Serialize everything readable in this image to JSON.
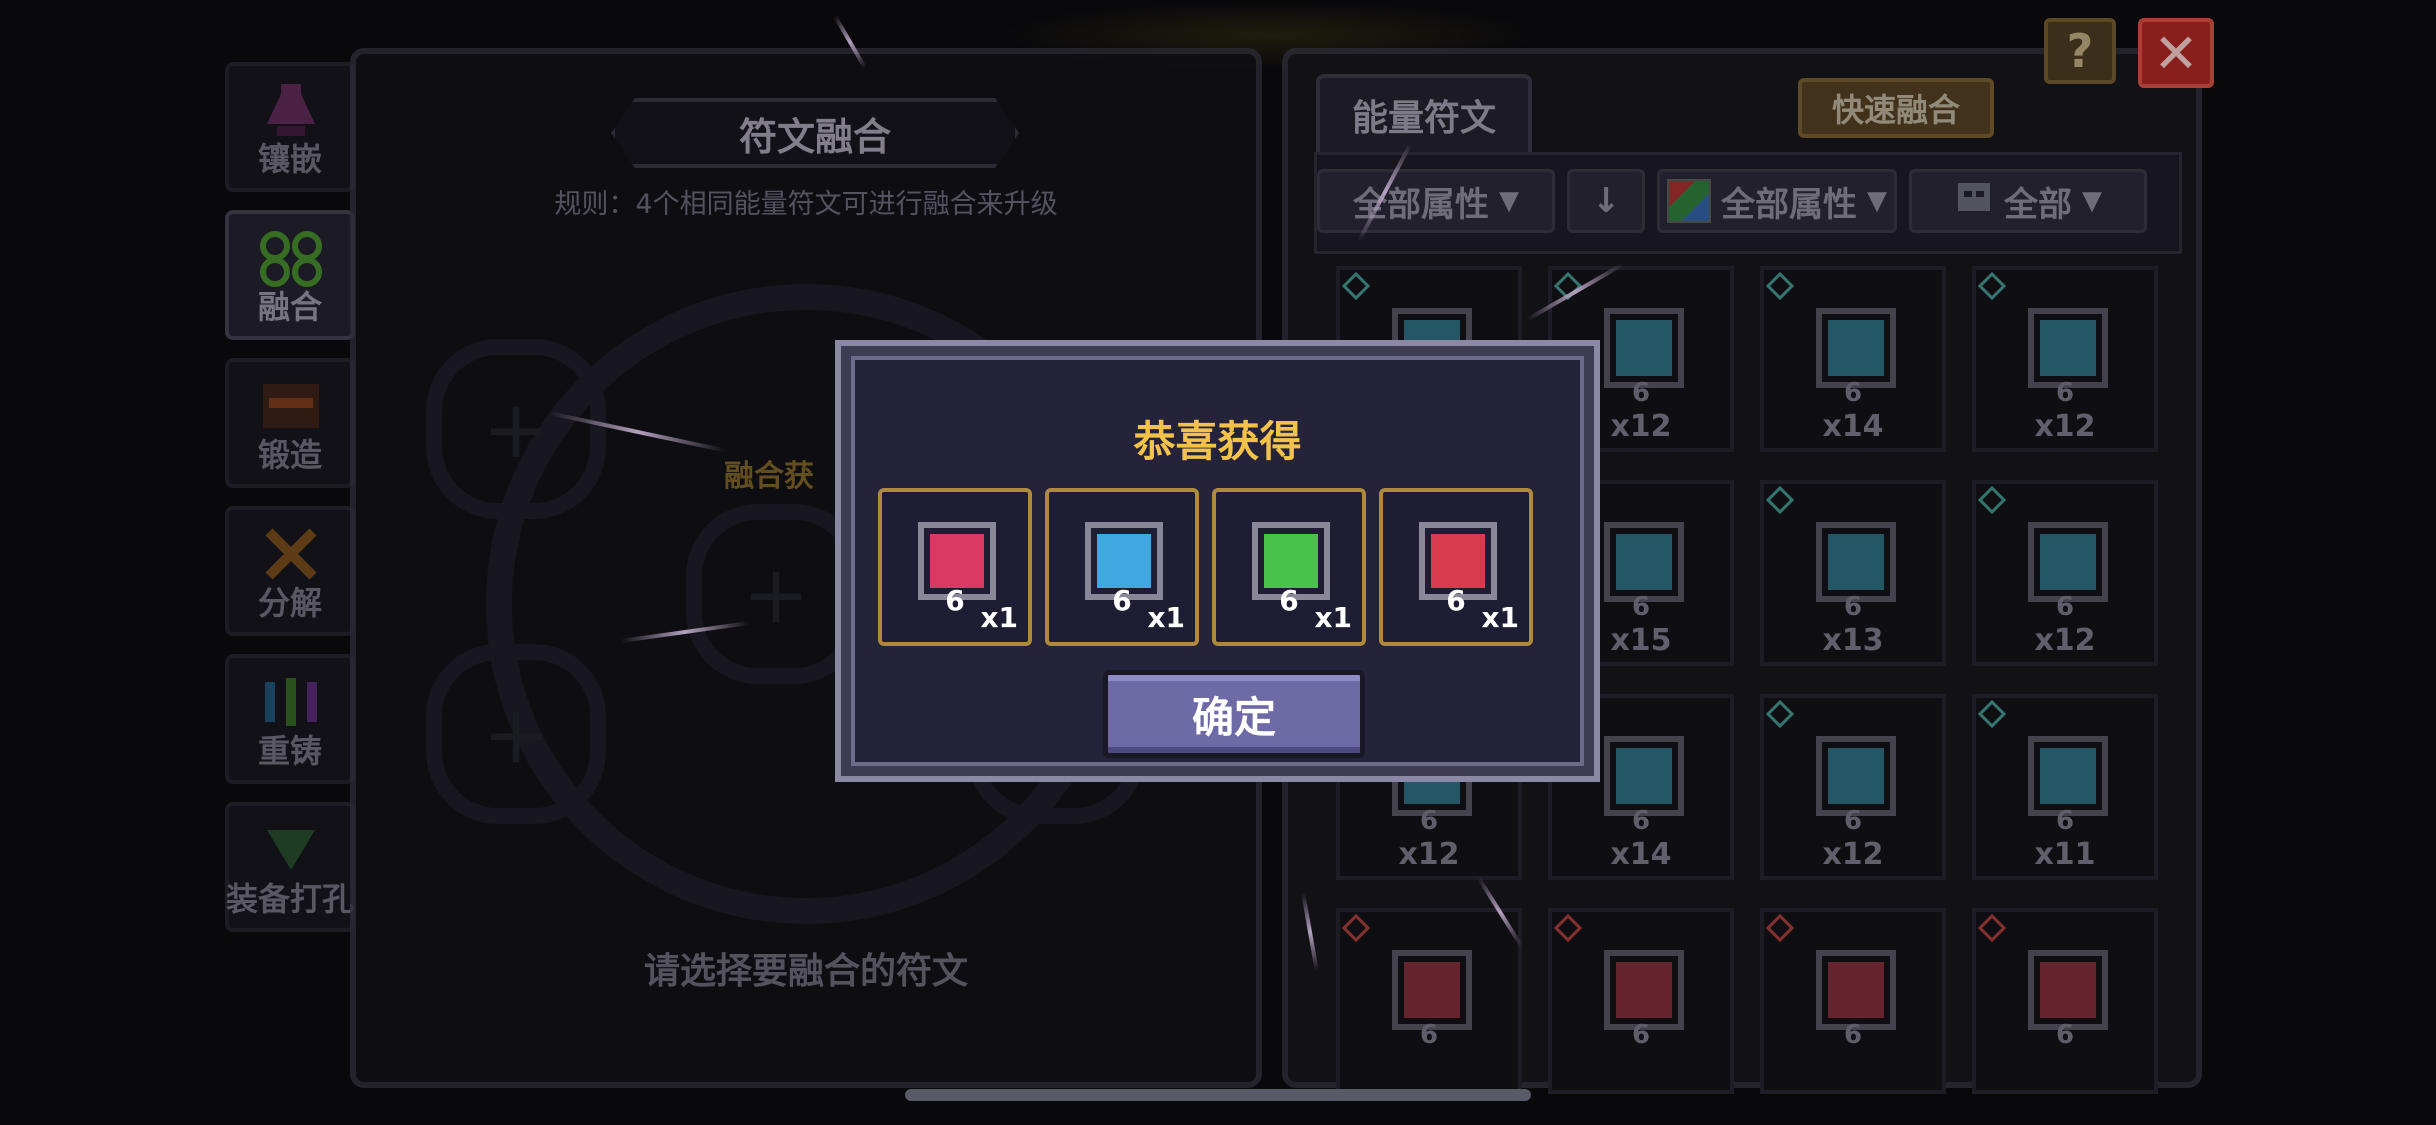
{
  "side_tabs": [
    {
      "label": "镶嵌",
      "icon": "potion-icon"
    },
    {
      "label": "融合",
      "icon": "fusion-icon"
    },
    {
      "label": "锻造",
      "icon": "forge-icon"
    },
    {
      "label": "分解",
      "icon": "decompose-icon"
    },
    {
      "label": "重铸",
      "icon": "recast-icon"
    },
    {
      "label": "装备打孔",
      "icon": "drill-icon"
    }
  ],
  "left_panel": {
    "title": "符文融合",
    "rule": "规则：4个相同能量符文可进行融合来升级",
    "fusion_label": "融合获",
    "hint": "请选择要融合的符文"
  },
  "right_panel": {
    "tab": "能量符文",
    "quick_fuse": "快速融合",
    "filters": {
      "attr1": "全部属性",
      "attr2": "全部属性",
      "category": "全部"
    },
    "grid": [
      {
        "count": "",
        "color": "#3b8fa8",
        "gem": "teal"
      },
      {
        "count": "x12",
        "color": "#3b8fa8",
        "gem": "teal"
      },
      {
        "count": "x14",
        "color": "#3b8fa8",
        "gem": "teal"
      },
      {
        "count": "x12",
        "color": "#3b8fa8",
        "gem": "teal"
      },
      {
        "count": "",
        "color": "#3b8fa8",
        "gem": ""
      },
      {
        "count": "x15",
        "color": "#3b8fa8",
        "gem": ""
      },
      {
        "count": "x13",
        "color": "#3b8fa8",
        "gem": "teal"
      },
      {
        "count": "x12",
        "color": "#3b8fa8",
        "gem": "teal"
      },
      {
        "count": "x12",
        "color": "#3b8fa8",
        "gem": ""
      },
      {
        "count": "x14",
        "color": "#3b8fa8",
        "gem": ""
      },
      {
        "count": "x12",
        "color": "#3b8fa8",
        "gem": "teal"
      },
      {
        "count": "x11",
        "color": "#3b8fa8",
        "gem": "teal"
      },
      {
        "count": "",
        "color": "#a63a4a",
        "gem": "red"
      },
      {
        "count": "",
        "color": "#a63a4a",
        "gem": "red"
      },
      {
        "count": "",
        "color": "#a63a4a",
        "gem": "red"
      },
      {
        "count": "",
        "color": "#a63a4a",
        "gem": "red"
      }
    ],
    "level": "6"
  },
  "modal": {
    "title": "恭喜获得",
    "rewards": [
      {
        "level": "6",
        "qty": "x1",
        "color": "#d83a63"
      },
      {
        "level": "6",
        "qty": "x1",
        "color": "#3fa8e0"
      },
      {
        "level": "6",
        "qty": "x1",
        "color": "#49c24a"
      },
      {
        "level": "6",
        "qty": "x1",
        "color": "#d83a4e"
      }
    ],
    "confirm": "确定"
  },
  "buttons": {
    "help": "?",
    "close": "✕"
  },
  "colors": {
    "accent_gold": "#f2c24a",
    "close_red": "#b72a26",
    "confirm_purple": "#6e6aa6"
  }
}
